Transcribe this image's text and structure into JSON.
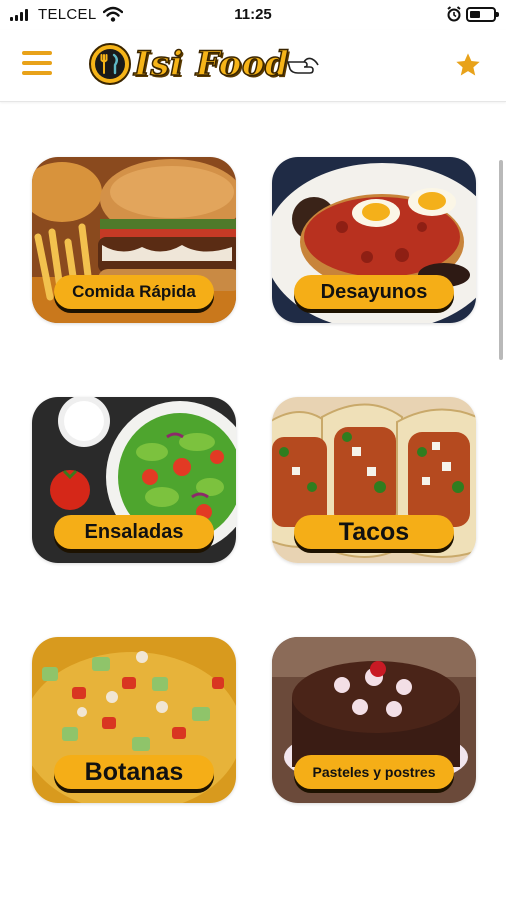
{
  "status_bar": {
    "carrier": "TELCEL",
    "time": "11:25"
  },
  "header": {
    "brand": "Isi Food",
    "menu_icon": "hamburger-menu-icon",
    "favorites_icon": "star-icon"
  },
  "colors": {
    "accent": "#f5ae17",
    "icon_orange": "#e8a21a"
  },
  "categories": [
    {
      "label": "Comida Rápida"
    },
    {
      "label": "Desayunos"
    },
    {
      "label": "Ensaladas"
    },
    {
      "label": "Tacos"
    },
    {
      "label": "Botanas"
    },
    {
      "label": "Pasteles y postres"
    }
  ]
}
